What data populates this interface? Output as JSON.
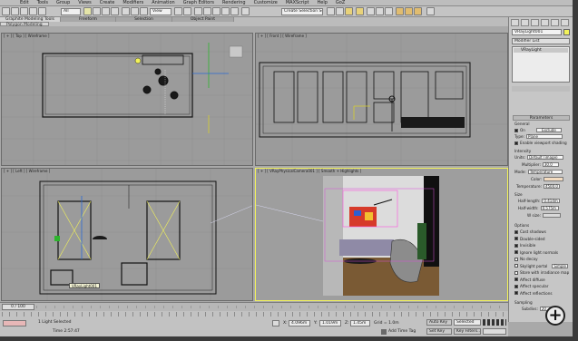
{
  "menubar": {
    "items": [
      "Edit",
      "Tools",
      "Group",
      "Views",
      "Create",
      "Modifiers",
      "Animation",
      "Graph Editors",
      "Rendering",
      "Customize",
      "MAXScript",
      "Help",
      "GoZ"
    ]
  },
  "toolbar": {
    "selection_filter": "All",
    "ref_coord": "View",
    "named_selection": "Create Selection Se"
  },
  "ribbon": {
    "tabs": [
      "Graphite Modeling Tools",
      "Freeform",
      "Selection",
      "Object Paint"
    ],
    "active_tab": "Graphite Modeling Tools",
    "sub_label": "Polygon Modeling"
  },
  "viewports": {
    "top_label": "[ + ] [ Top ] [ Wireframe ]",
    "front_label": "[ + ] [ Front ] [ Wireframe ]",
    "left_label": "[ + ] [ Left ] [ Wireframe ]",
    "camera_label": "[ + ] [ VRayPhysicalCamera001 ] [ Smooth + Highlights ]",
    "tooltip": "VRayLight001"
  },
  "command_panel": {
    "object_name": "VRayLight001",
    "modifier_list": "Modifier List",
    "stack_item": "VRayLight",
    "parameters_title": "Parameters",
    "general_label": "General",
    "on_label": "On",
    "exclude_label": "Exclude",
    "type_label": "Type:",
    "type_value": "Plane",
    "enable_shading": "Enable viewport shading",
    "intensity_label": "Intensity",
    "units_label": "Units:",
    "units_value": "Default (image)",
    "multiplier_label": "Multiplier:",
    "multiplier_value": "30.0",
    "mode_label": "Mode:",
    "mode_value": "Temperature",
    "color_label": "Color:",
    "temperature_label": "Temperature:",
    "temperature_value": "4500.0",
    "size_label": "Size",
    "half_length_label": "Half-length:",
    "half_length_value": "0.414m",
    "half_width_label": "Half-width:",
    "half_width_value": "0.575m",
    "w_size_label": "W size:",
    "options_label": "Options",
    "options": [
      "Cast shadows",
      "Double-sided",
      "Invisible",
      "Ignore light normals",
      "No decay",
      "Skylight portal",
      "Store with irradiance map",
      "Affect diffuse",
      "Affect specular",
      "Affect reflections"
    ],
    "options_checked": [
      true,
      true,
      true,
      true,
      false,
      false,
      false,
      true,
      true,
      true
    ],
    "skylight_extra": "Simple",
    "sampling_label": "Sampling",
    "subdivs_label": "Subdivs:",
    "subdivs_value": "20"
  },
  "timeline": {
    "frame_display": "0 / 100"
  },
  "status": {
    "light_selected": "1 Light Selected",
    "time": "Time 2:57:47",
    "x_value": "4.096m",
    "y_value": "1.019m",
    "z_value": "1.45m",
    "grid": "Grid = 1.0m",
    "auto_key": "Auto Key",
    "set_key": "Set Key",
    "key_mode": "Selected",
    "key_filters": "Key Filters...",
    "add_time_tag": "Add Time Tag"
  },
  "colors": {
    "selected_highlight": "#f2f25a",
    "viewport_bg": "#9b9b9b",
    "grid_line": "#8e8e8e",
    "render_floor": "#7a5a34",
    "render_wall": "#dcdcdc"
  }
}
